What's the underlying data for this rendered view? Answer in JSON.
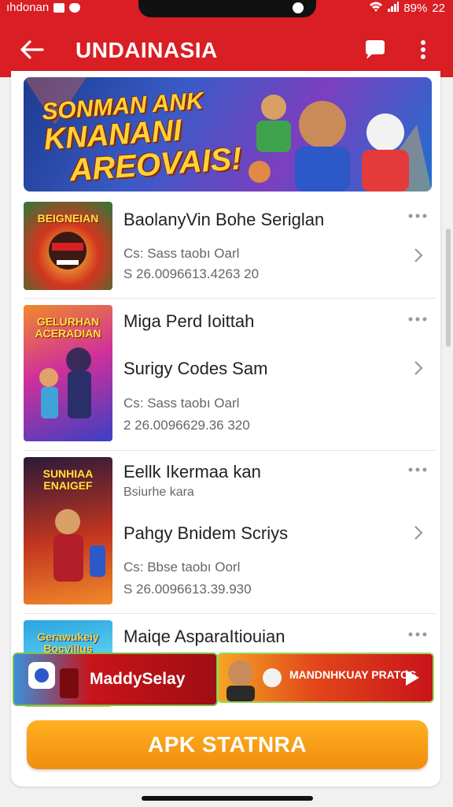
{
  "status_bar": {
    "carrier": "ıhdonan",
    "time": "22",
    "battery": "89%"
  },
  "app_bar": {
    "title": "UNDAINASIA"
  },
  "banner": {
    "line1": "SONMAN ANK",
    "line2": "KNANANI",
    "line3": "AREOVAIS!"
  },
  "games": [
    {
      "thumb_label": "BEIGNEIAN",
      "title": "BaolanyVin Bohe Seriglan",
      "line1": "Cs: Sass taobı Oarl",
      "line2": "S 26.0096613.4263 20"
    },
    {
      "thumb_label": "GELURHAN ACERADIAN",
      "title": "Miga Perd Ioittah",
      "subtitle": "Surigy Codes Sam",
      "line1": "Cs: Sass taobı Oarl",
      "line2": "2 26.0096629.36 320"
    },
    {
      "thumb_label": "SUNHIAA ENAIGEF",
      "title": "Eellk Ikermaa kan",
      "small": "Bsiurhe kara",
      "subtitle": "Pahgy Bnidem Scriys",
      "line1": "Cs: Bbse taobı Oorl",
      "line2": "S 26.0096613.39.930"
    },
    {
      "thumb_label": "Gerawukeiy Bocvillus",
      "title": "Maiqe AsparaItiouian"
    }
  ],
  "ads": {
    "left_label": "MaddySelay",
    "right_label": "MANDNHKUAY PRATOS"
  },
  "cta_label": "APK STATNRA"
}
